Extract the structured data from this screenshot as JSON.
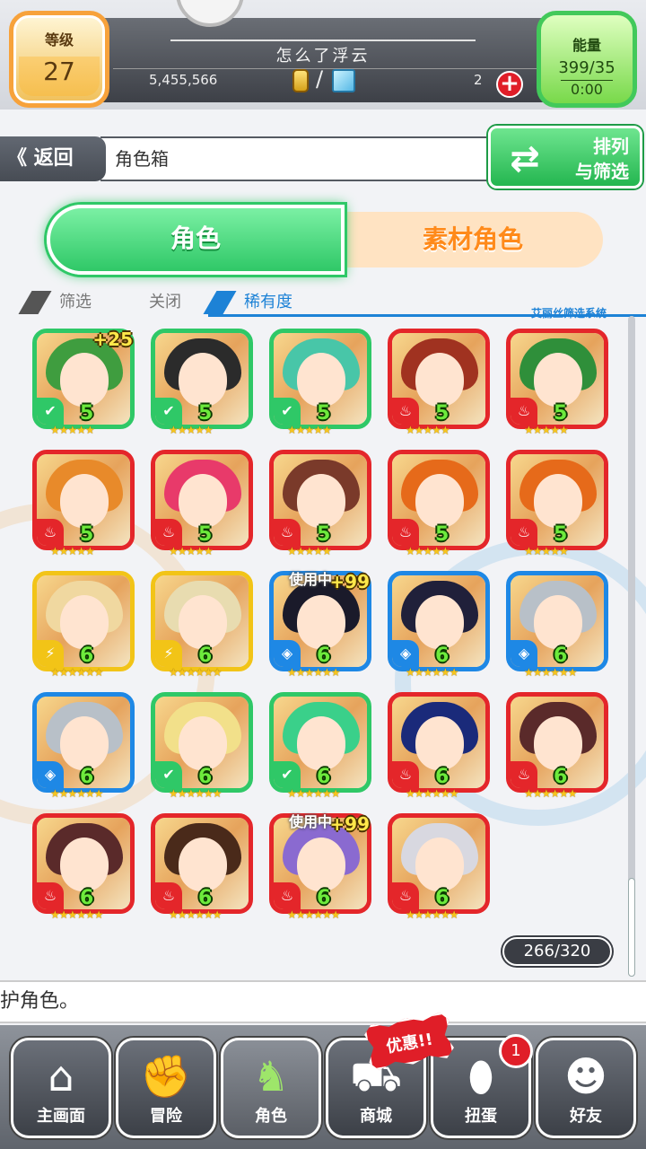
{
  "header": {
    "level_label": "等级",
    "level_value": "27",
    "username": "怎么了浮云",
    "money": "5,455,566",
    "gems": "2",
    "energy_label": "能量",
    "energy_value": "399/35",
    "energy_timer": "0:00"
  },
  "nav_bar": {
    "back_label": "返回",
    "page_title": "角色箱",
    "sort_label_1": "排列",
    "sort_label_2": "与筛选"
  },
  "tabs": [
    {
      "label": "角色",
      "active": true
    },
    {
      "label": "素材角色",
      "active": false
    }
  ],
  "filter": {
    "filter_label": "筛选",
    "filter_value": "关闭",
    "sort_value": "稀有度",
    "system_label": "艾丽丝筛选系统"
  },
  "characters": [
    {
      "element": "wood",
      "rarity": "5",
      "stars": "★★★★★",
      "bonus": "+25",
      "in_use": ""
    },
    {
      "element": "wood",
      "rarity": "5",
      "stars": "★★★★★",
      "bonus": "",
      "in_use": ""
    },
    {
      "element": "wood",
      "rarity": "5",
      "stars": "★★★★★",
      "bonus": "",
      "in_use": ""
    },
    {
      "element": "fire",
      "rarity": "5",
      "stars": "★★★★★",
      "bonus": "",
      "in_use": ""
    },
    {
      "element": "fire",
      "rarity": "5",
      "stars": "★★★★★",
      "bonus": "",
      "in_use": ""
    },
    {
      "element": "fire",
      "rarity": "5",
      "stars": "★★★★★",
      "bonus": "",
      "in_use": ""
    },
    {
      "element": "fire",
      "rarity": "5",
      "stars": "★★★★★",
      "bonus": "",
      "in_use": ""
    },
    {
      "element": "fire",
      "rarity": "5",
      "stars": "★★★★★",
      "bonus": "",
      "in_use": ""
    },
    {
      "element": "fire",
      "rarity": "5",
      "stars": "★★★★★",
      "bonus": "",
      "in_use": ""
    },
    {
      "element": "fire",
      "rarity": "5",
      "stars": "★★★★★",
      "bonus": "",
      "in_use": ""
    },
    {
      "element": "light",
      "rarity": "6",
      "stars": "★★★★★★",
      "bonus": "",
      "in_use": ""
    },
    {
      "element": "light",
      "rarity": "6",
      "stars": "★★★★★★",
      "bonus": "",
      "in_use": ""
    },
    {
      "element": "water",
      "rarity": "6",
      "stars": "★★★★★★",
      "bonus": "+99",
      "in_use": "使用中"
    },
    {
      "element": "water",
      "rarity": "6",
      "stars": "★★★★★★",
      "bonus": "",
      "in_use": ""
    },
    {
      "element": "water",
      "rarity": "6",
      "stars": "★★★★★★",
      "bonus": "",
      "in_use": ""
    },
    {
      "element": "water",
      "rarity": "6",
      "stars": "★★★★★★",
      "bonus": "",
      "in_use": ""
    },
    {
      "element": "wood",
      "rarity": "6",
      "stars": "★★★★★★",
      "bonus": "",
      "in_use": ""
    },
    {
      "element": "wood",
      "rarity": "6",
      "stars": "★★★★★★",
      "bonus": "",
      "in_use": ""
    },
    {
      "element": "fire",
      "rarity": "6",
      "stars": "★★★★★★",
      "bonus": "",
      "in_use": ""
    },
    {
      "element": "fire",
      "rarity": "6",
      "stars": "★★★★★★",
      "bonus": "",
      "in_use": ""
    },
    {
      "element": "fire",
      "rarity": "6",
      "stars": "★★★★★★",
      "bonus": "",
      "in_use": ""
    },
    {
      "element": "fire",
      "rarity": "6",
      "stars": "★★★★★★",
      "bonus": "",
      "in_use": ""
    },
    {
      "element": "fire",
      "rarity": "6",
      "stars": "★★★★★★",
      "bonus": "+99",
      "in_use": "使用中"
    },
    {
      "element": "fire",
      "rarity": "6",
      "stars": "★★★★★★",
      "bonus": "",
      "in_use": ""
    }
  ],
  "box_count": "266/320",
  "message": "保护角色。",
  "bottom_nav": [
    {
      "label": "主画面",
      "icon": "home-icon",
      "active": false
    },
    {
      "label": "冒险",
      "icon": "handshake-icon",
      "active": false
    },
    {
      "label": "角色",
      "icon": "rabbit-icon",
      "active": true
    },
    {
      "label": "商城",
      "icon": "cart-icon",
      "active": false
    },
    {
      "label": "扭蛋",
      "icon": "egg-icon",
      "active": false
    },
    {
      "label": "好友",
      "icon": "friends-icon",
      "active": false
    }
  ],
  "promo_label": "优惠!!",
  "gacha_badge": "1",
  "colors": {
    "fire": "#e4262a",
    "water": "#1e88e5",
    "wood": "#2fc867",
    "light": "#f2c417",
    "accent_green": "#2fc867",
    "accent_orange": "#ff8a1a"
  }
}
